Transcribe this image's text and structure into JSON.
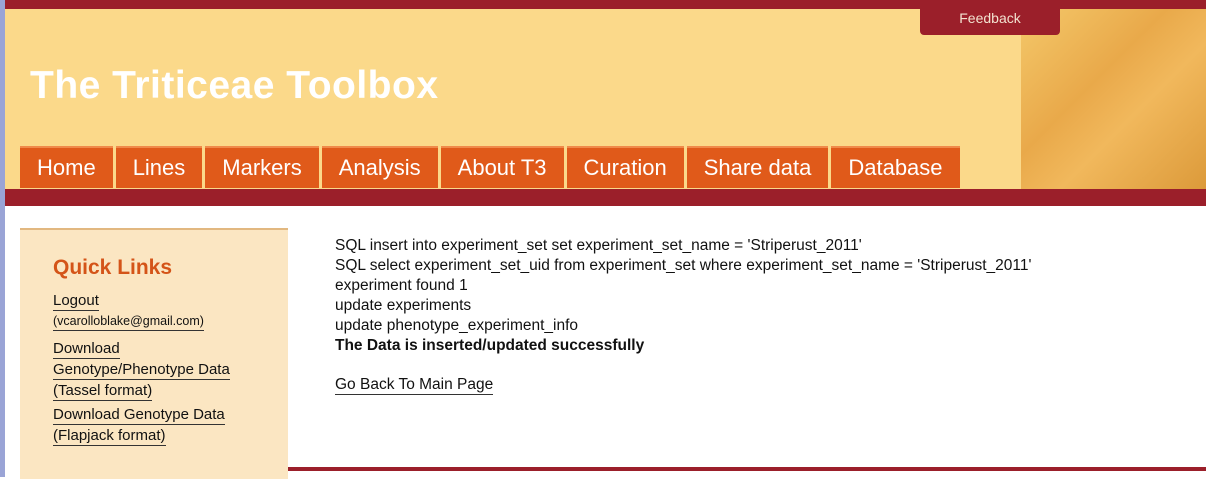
{
  "header": {
    "feedback_label": "Feedback",
    "site_title": "The Triticeae Toolbox"
  },
  "nav": {
    "tabs": [
      {
        "label": "Home"
      },
      {
        "label": "Lines"
      },
      {
        "label": "Markers"
      },
      {
        "label": "Analysis"
      },
      {
        "label": "About T3"
      },
      {
        "label": "Curation"
      },
      {
        "label": "Share data"
      },
      {
        "label": "Database"
      }
    ]
  },
  "sidebar": {
    "title": "Quick Links",
    "logout_label": "Logout",
    "user_email": "(vcarolloblake@gmail.com)",
    "download_tassel_line1": "Download",
    "download_tassel_line2": "Genotype/Phenotype Data",
    "download_tassel_line3": "(Tassel format)",
    "download_flapjack_line1": "Download Genotype Data",
    "download_flapjack_line2": "(Flapjack format)"
  },
  "main": {
    "messages": [
      "SQL insert into experiment_set set experiment_set_name = 'Striperust_2011'",
      "SQL select experiment_set_uid from experiment_set where experiment_set_name = 'Striperust_2011'",
      "experiment found 1",
      "update experiments",
      "update phenotype_experiment_info"
    ],
    "success_message": "The Data is inserted/updated successfully",
    "back_link": "Go Back To Main Page"
  },
  "colors": {
    "brand_dark_red": "#9b1f2a",
    "header_bg": "#fbd98a",
    "tab_orange": "#e05a1a",
    "sidebar_bg": "#fbe6c2",
    "quick_links_title": "#d45418"
  }
}
